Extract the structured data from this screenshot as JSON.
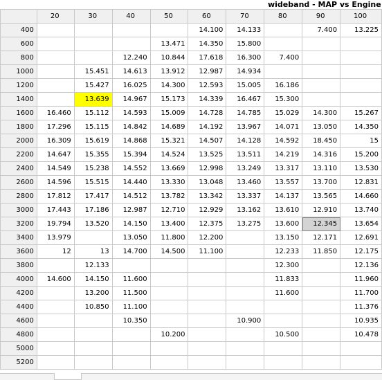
{
  "window": {
    "title": "wideband - MAP vs Engine R"
  },
  "grid": {
    "columns": [
      "20",
      "30",
      "40",
      "50",
      "60",
      "70",
      "80",
      "90",
      "100"
    ],
    "rows": [
      {
        "label": "400",
        "cells": [
          "",
          "",
          "",
          "",
          "14.100",
          "14.133",
          "",
          "7.400",
          "13.225"
        ]
      },
      {
        "label": "600",
        "cells": [
          "",
          "",
          "",
          "13.471",
          "14.350",
          "15.800",
          "",
          "",
          ""
        ]
      },
      {
        "label": "800",
        "cells": [
          "",
          "",
          "12.240",
          "10.844",
          "17.618",
          "16.300",
          "7.400",
          "",
          ""
        ]
      },
      {
        "label": "1000",
        "cells": [
          "",
          "15.451",
          "14.613",
          "13.912",
          "12.987",
          "14.934",
          "",
          "",
          ""
        ]
      },
      {
        "label": "1200",
        "cells": [
          "",
          "15.427",
          "16.025",
          "14.300",
          "12.593",
          "15.005",
          "16.186",
          "",
          ""
        ]
      },
      {
        "label": "1400",
        "cells": [
          "",
          "13.639",
          "14.967",
          "15.173",
          "14.339",
          "16.467",
          "15.300",
          "",
          ""
        ]
      },
      {
        "label": "1600",
        "cells": [
          "16.460",
          "15.112",
          "14.593",
          "15.009",
          "14.728",
          "14.785",
          "15.029",
          "14.300",
          "15.267"
        ]
      },
      {
        "label": "1800",
        "cells": [
          "17.296",
          "15.115",
          "14.842",
          "14.689",
          "14.192",
          "13.967",
          "14.071",
          "13.050",
          "14.350"
        ]
      },
      {
        "label": "2000",
        "cells": [
          "16.309",
          "15.619",
          "14.868",
          "15.321",
          "14.507",
          "14.128",
          "14.592",
          "18.450",
          "15"
        ]
      },
      {
        "label": "2200",
        "cells": [
          "14.647",
          "15.355",
          "15.394",
          "14.524",
          "13.525",
          "13.511",
          "14.219",
          "14.316",
          "15.200"
        ]
      },
      {
        "label": "2400",
        "cells": [
          "14.549",
          "15.238",
          "14.552",
          "13.669",
          "12.998",
          "13.249",
          "13.317",
          "13.110",
          "13.530"
        ]
      },
      {
        "label": "2600",
        "cells": [
          "14.596",
          "15.515",
          "14.440",
          "13.330",
          "13.048",
          "13.460",
          "13.557",
          "13.700",
          "12.831"
        ]
      },
      {
        "label": "2800",
        "cells": [
          "17.812",
          "17.417",
          "14.512",
          "13.782",
          "13.342",
          "13.337",
          "14.137",
          "13.565",
          "14.660"
        ]
      },
      {
        "label": "3000",
        "cells": [
          "17.443",
          "17.186",
          "12.987",
          "12.710",
          "12.929",
          "13.162",
          "13.610",
          "12.910",
          "13.740"
        ]
      },
      {
        "label": "3200",
        "cells": [
          "19.794",
          "13.520",
          "14.150",
          "13.400",
          "12.375",
          "13.275",
          "13.600",
          "12.345",
          "13.654"
        ]
      },
      {
        "label": "3400",
        "cells": [
          "13.979",
          "",
          "13.050",
          "11.800",
          "12.200",
          "",
          "13.150",
          "12.171",
          "12.691"
        ]
      },
      {
        "label": "3600",
        "cells": [
          "12",
          "13",
          "14.700",
          "14.500",
          "11.100",
          "",
          "12.233",
          "11.850",
          "12.175"
        ]
      },
      {
        "label": "3800",
        "cells": [
          "",
          "12.133",
          "",
          "",
          "",
          "",
          "12.300",
          "",
          "12.136"
        ]
      },
      {
        "label": "4000",
        "cells": [
          "14.600",
          "14.150",
          "11.600",
          "",
          "",
          "",
          "11.833",
          "",
          "11.960"
        ]
      },
      {
        "label": "4200",
        "cells": [
          "",
          "13.200",
          "11.500",
          "",
          "",
          "",
          "11.600",
          "",
          "11.700"
        ]
      },
      {
        "label": "4400",
        "cells": [
          "",
          "10.850",
          "11.100",
          "",
          "",
          "",
          "",
          "",
          "11.376"
        ]
      },
      {
        "label": "4600",
        "cells": [
          "",
          "",
          "10.350",
          "",
          "",
          "10.900",
          "",
          "",
          "10.935"
        ]
      },
      {
        "label": "4800",
        "cells": [
          "",
          "",
          "",
          "10.200",
          "",
          "",
          "10.500",
          "",
          "10.478"
        ]
      },
      {
        "label": "5000",
        "cells": [
          "",
          "",
          "",
          "",
          "",
          "",
          "",
          "",
          ""
        ]
      },
      {
        "label": "5200",
        "cells": [
          "",
          "",
          "",
          "",
          "",
          "",
          "",
          "",
          ""
        ]
      }
    ],
    "highlight": {
      "row": 5,
      "col": 1,
      "color": "#ffff00"
    },
    "selected": {
      "row": 14,
      "col": 7
    }
  }
}
